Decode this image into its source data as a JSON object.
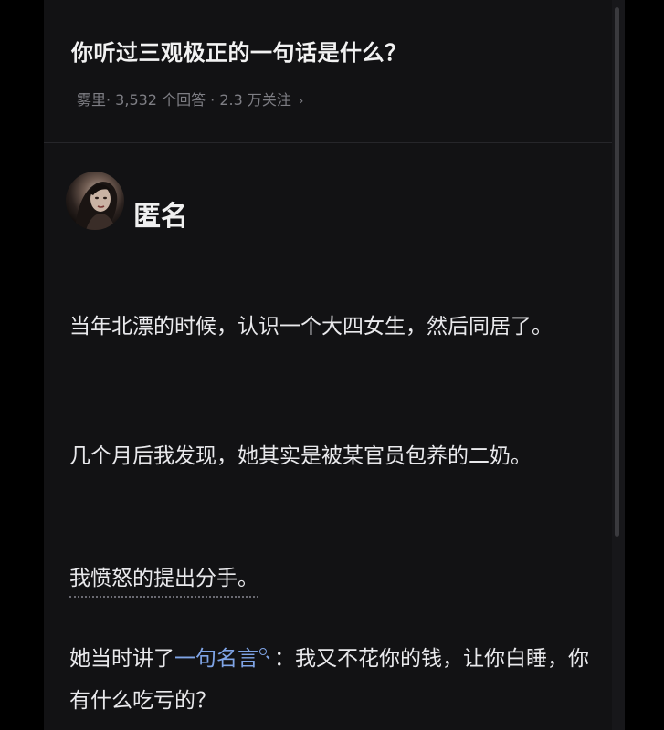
{
  "question": {
    "title": "你听过三观极正的一句话是什么？",
    "meta": "雾里· 3,532 个回答 · 2.3 万关注",
    "chevron": "›"
  },
  "answer": {
    "author": "匿名",
    "avatar_icon": "user-avatar-photo",
    "paragraphs": [
      "当年北漂的时候，认识一个大四女生，然后同居了。",
      "几个月后我发现，她其实是被某官员包养的二奶。",
      "我愤怒的提出分手。"
    ],
    "last_paragraph": {
      "before": "她当时讲了",
      "link": "一句名言",
      "after": "：我又不花你的钱，让你白睡，你有什么吃亏的？"
    }
  },
  "colors": {
    "background": "#121214",
    "text": "#e9e9ec",
    "meta": "#7e7e84",
    "link": "#7fa4e6"
  }
}
